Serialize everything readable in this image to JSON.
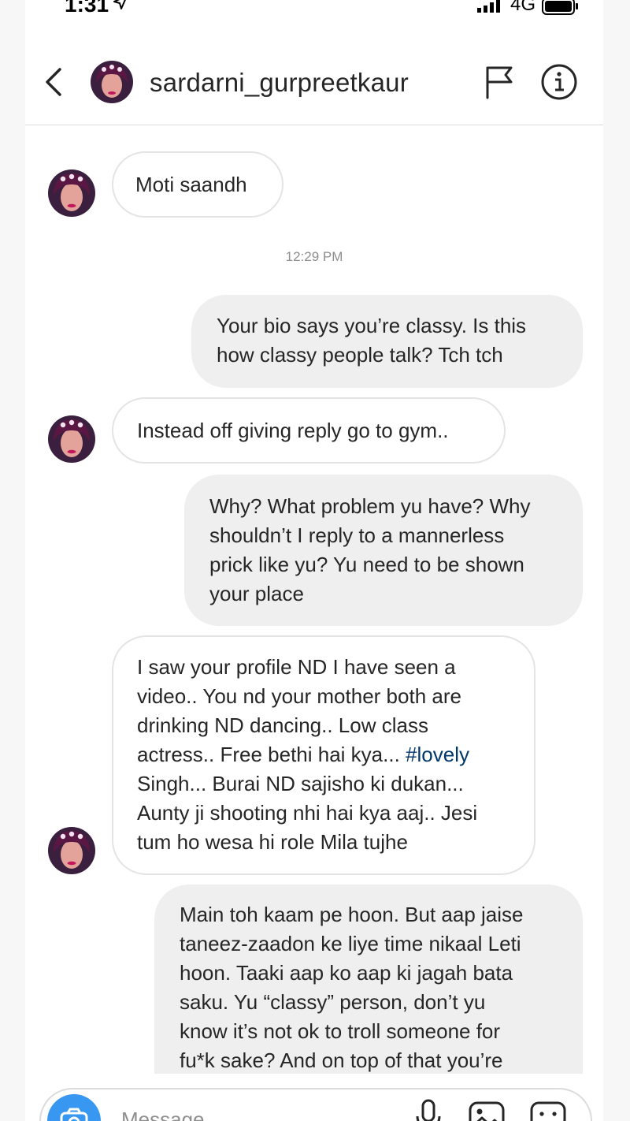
{
  "status_bar": {
    "time": "1:31",
    "network": "4G"
  },
  "header": {
    "username": "sardarni_gurpreetkaur"
  },
  "icons": {
    "back": "chevron-left-icon",
    "flag": "flag-icon",
    "info": "info-icon",
    "camera": "camera-icon",
    "mic": "microphone-icon",
    "gallery": "gallery-icon",
    "sticker": "sticker-icon"
  },
  "colors": {
    "outgoing_bubble": "#efefef",
    "incoming_border": "#e4e4e4",
    "hashtag": "#00376b",
    "camera_button": "#3897f0"
  },
  "messages": [
    {
      "direction": "in",
      "text": "Moti saandh"
    },
    {
      "direction": "timestamp",
      "text": "12:29 PM"
    },
    {
      "direction": "out",
      "text": "Your bio says you’re classy. Is this\nhow classy people talk? Tch tch"
    },
    {
      "direction": "in",
      "text": "Instead off giving reply go to gym.."
    },
    {
      "direction": "out",
      "text": "Why? What problem yu have? Why\nshouldn’t I reply to a mannerless\nprick like yu? Yu need to be shown\nyour place"
    },
    {
      "direction": "in",
      "text_before": "I saw your profile ND I have seen a\nvideo.. You nd your mother both are\ndrinking ND dancing.. Low class\nactress.. Free bethi hai kya... ",
      "hashtag": "#lovely",
      "text_after": "\nSingh... Burai ND sajisho ki dukan...\nAunty ji shooting nhi hai kya aaj.. Jesi\ntum ho wesa hi role Mila tujhe"
    },
    {
      "direction": "out",
      "text": "Main toh kaam pe hoon. But aap jaise\ntaneez-zaadon ke liye time nikaal Leti\nhoon. Taaki aap ko aap ki jagah bata\nsaku. Yu “classy” person, don’t yu\nknow it’s not ok to troll someone for\nfu*k sake? And on top of that you’re"
    }
  ],
  "composer": {
    "placeholder": "Message..."
  }
}
